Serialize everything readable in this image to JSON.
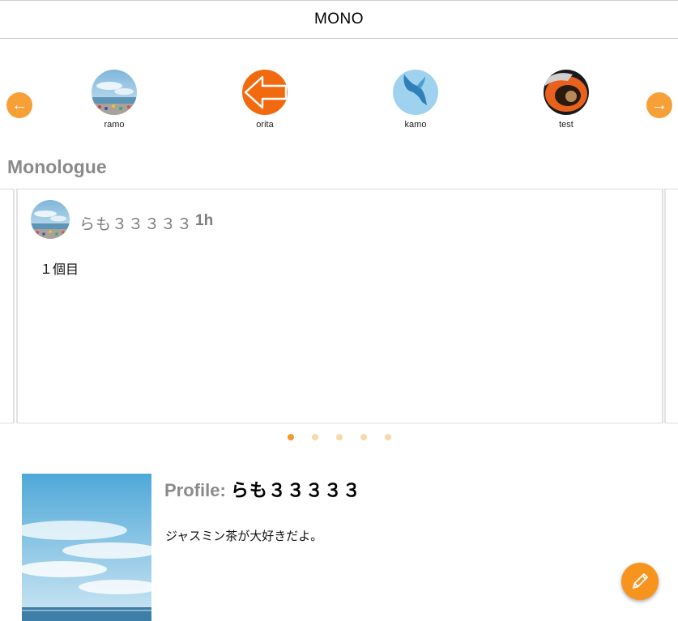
{
  "header": {
    "title": "MONO"
  },
  "user_strip": {
    "prev_icon": "arrow-left-icon",
    "next_icon": "arrow-right-icon",
    "users": [
      {
        "name": "ramo",
        "avatar": "beach-photo"
      },
      {
        "name": "orita",
        "avatar": "orange-left-arrow"
      },
      {
        "name": "kamo",
        "avatar": "blue-bird-photo"
      },
      {
        "name": "test",
        "avatar": "orange-fish-photo"
      }
    ]
  },
  "monologue": {
    "section_title": "Monologue",
    "post": {
      "author": "らも３３３３３",
      "time": "1h",
      "text": "１個目"
    }
  },
  "pagination": {
    "count": 5,
    "active_index": 0
  },
  "profile": {
    "label": "Profile:",
    "name": "らも３３３３３",
    "bio": "ジャスミン茶が大好きだよ。"
  },
  "fab": {
    "icon": "pencil-icon"
  },
  "colors": {
    "accent": "#f7941d",
    "dot_active": "#f29a2c",
    "dot_inactive": "#f8d9a8",
    "muted_text": "#8a8a8a"
  }
}
